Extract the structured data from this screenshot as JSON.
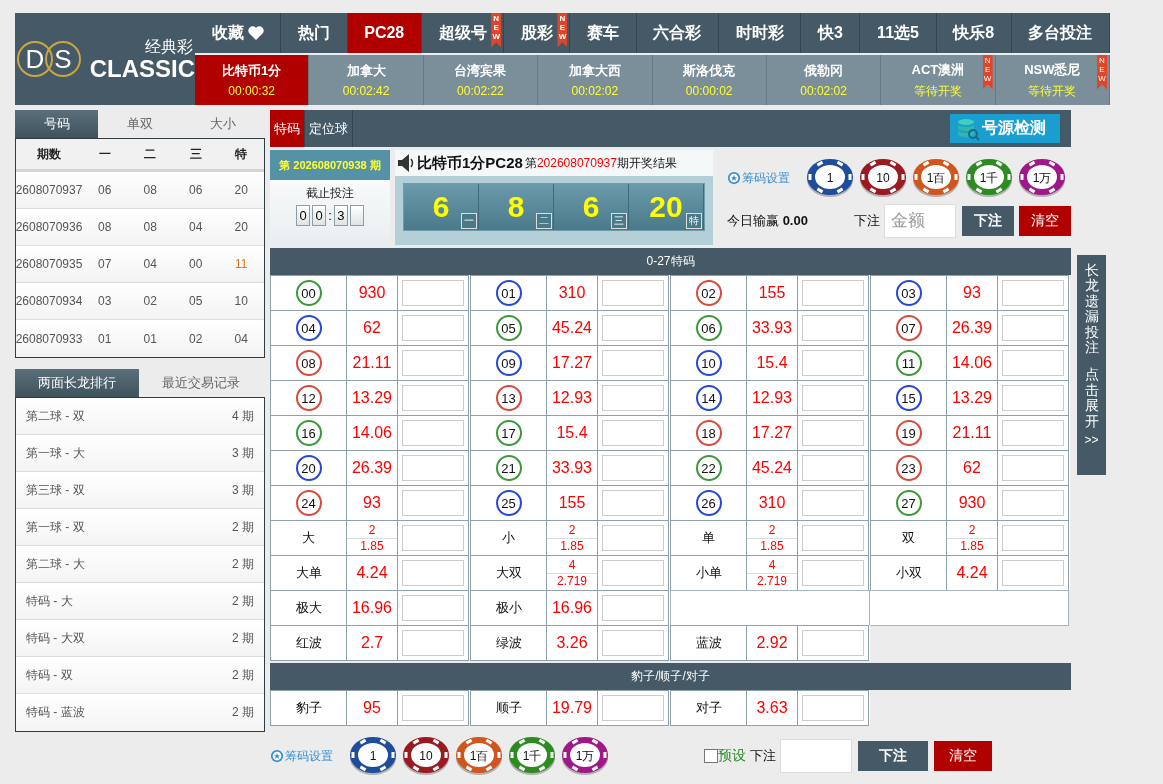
{
  "logo": {
    "letters": [
      "D",
      "S"
    ],
    "brand_cn": "经典彩",
    "brand_en": "CLASSIC"
  },
  "nav": [
    {
      "label": "收藏",
      "selected": false
    },
    {
      "label": "热门",
      "selected": false
    },
    {
      "label": "PC28",
      "selected": true
    },
    {
      "label": "超级号",
      "selected": false,
      "badge": "NEW"
    },
    {
      "label": "股彩",
      "selected": false,
      "badge": "NEW"
    },
    {
      "label": "赛车",
      "selected": false
    },
    {
      "label": "六合彩",
      "selected": false
    },
    {
      "label": "时时彩",
      "selected": false
    },
    {
      "label": "快3",
      "selected": false
    },
    {
      "label": "11选5",
      "selected": false
    },
    {
      "label": "快乐8",
      "selected": false
    },
    {
      "label": "多台投注",
      "selected": false
    }
  ],
  "games": [
    {
      "name": "比特币1分",
      "time": "00:00:32",
      "selected": true
    },
    {
      "name": "加拿大",
      "time": "00:02:42",
      "selected": false
    },
    {
      "name": "台湾宾果",
      "time": "00:02:22",
      "selected": false
    },
    {
      "name": "加拿大西",
      "time": "00:02:02",
      "selected": false
    },
    {
      "name": "斯洛伐克",
      "time": "00:00:02",
      "selected": false
    },
    {
      "name": "俄勒冈",
      "time": "00:02:02",
      "selected": false
    },
    {
      "name": "ACT澳洲",
      "time": "等待开奖",
      "selected": false,
      "badge": "NEW"
    },
    {
      "name": "NSW悉尼",
      "time": "等待开奖",
      "selected": false,
      "badge": "NEW"
    }
  ],
  "history_tabs": [
    {
      "label": "号码",
      "selected": true
    },
    {
      "label": "单双",
      "selected": false
    },
    {
      "label": "大小",
      "selected": false
    }
  ],
  "history": {
    "columns": [
      "期数",
      "一",
      "二",
      "三",
      "特"
    ],
    "rows": [
      {
        "cells": [
          "2608070937",
          "06",
          "08",
          "06",
          "20"
        ],
        "highlight": false
      },
      {
        "cells": [
          "2608070936",
          "08",
          "08",
          "04",
          "20"
        ],
        "highlight": false
      },
      {
        "cells": [
          "2608070935",
          "07",
          "04",
          "00",
          "11"
        ],
        "highlight": true
      },
      {
        "cells": [
          "2608070934",
          "03",
          "02",
          "05",
          "10"
        ],
        "highlight": false
      },
      {
        "cells": [
          "2608070933",
          "01",
          "01",
          "02",
          "04"
        ],
        "highlight": false
      }
    ]
  },
  "ranking_tabs": [
    {
      "label": "两面长龙排行",
      "selected": true
    },
    {
      "label": "最近交易记录",
      "selected": false
    }
  ],
  "ranking": [
    {
      "label": "第二球 - 双",
      "count": "4 期"
    },
    {
      "label": "第一球 - 大",
      "count": "3 期"
    },
    {
      "label": "第三球 - 双",
      "count": "3 期"
    },
    {
      "label": "第一球 - 双",
      "count": "2 期"
    },
    {
      "label": "第二球 - 大",
      "count": "2 期"
    },
    {
      "label": "特码 - 大",
      "count": "2 期"
    },
    {
      "label": "特码 - 大双",
      "count": "2 期"
    },
    {
      "label": "特码 - 双",
      "count": "2 期"
    },
    {
      "label": "特码 - 蓝波",
      "count": "2 期"
    }
  ],
  "bet_tabs": [
    {
      "label": "特码",
      "selected": true
    },
    {
      "label": "定位球",
      "selected": false
    }
  ],
  "source_button": "号源检测",
  "current": {
    "prefix": "第",
    "period": "202608070938",
    "suffix": "期",
    "deadline_label": "截止投注",
    "minutes": [
      "0",
      "0"
    ],
    "separator": ":",
    "seconds": [
      "3"
    ]
  },
  "result": {
    "game": "比特币1分PC28",
    "prefix": "第",
    "period": "202608070937",
    "suffix": "期开奖结果",
    "balls": [
      {
        "value": "6",
        "label": "一"
      },
      {
        "value": "8",
        "label": "二"
      },
      {
        "value": "6",
        "label": "三"
      },
      {
        "value": "20",
        "label": "特"
      }
    ]
  },
  "chip_setting": "筹码设置",
  "chips": [
    {
      "label": "1",
      "color": "#1f4c9c"
    },
    {
      "label": "10",
      "color": "#9a1a22"
    },
    {
      "label": "1百",
      "color": "#d0561e"
    },
    {
      "label": "1千",
      "color": "#2e8b22"
    },
    {
      "label": "1万",
      "color": "#a0178a"
    }
  ],
  "today": {
    "label": "今日输赢",
    "value": "0.00"
  },
  "bet": {
    "label": "下注",
    "placeholder": "金额",
    "submit": "下注",
    "clear": "清空"
  },
  "sections": [
    {
      "title": "0-27特码",
      "rows": [
        [
          {
            "kind": "ball",
            "number": "00",
            "color": "#3a9a3a",
            "odds": [
              "930"
            ]
          },
          {
            "kind": "ball",
            "number": "01",
            "color": "#2448d8",
            "odds": [
              "310"
            ]
          },
          {
            "kind": "ball",
            "number": "02",
            "color": "#d84a3a",
            "odds": [
              "155"
            ]
          },
          {
            "kind": "ball",
            "number": "03",
            "color": "#2448d8",
            "odds": [
              "93"
            ]
          }
        ],
        [
          {
            "kind": "ball",
            "number": "04",
            "color": "#2448d8",
            "odds": [
              "62"
            ]
          },
          {
            "kind": "ball",
            "number": "05",
            "color": "#3a9a3a",
            "odds": [
              "45.24"
            ]
          },
          {
            "kind": "ball",
            "number": "06",
            "color": "#3a9a3a",
            "odds": [
              "33.93"
            ]
          },
          {
            "kind": "ball",
            "number": "07",
            "color": "#d84a3a",
            "odds": [
              "26.39"
            ]
          }
        ],
        [
          {
            "kind": "ball",
            "number": "08",
            "color": "#d84a3a",
            "odds": [
              "21.11"
            ]
          },
          {
            "kind": "ball",
            "number": "09",
            "color": "#2448d8",
            "odds": [
              "17.27"
            ]
          },
          {
            "kind": "ball",
            "number": "10",
            "color": "#2448d8",
            "odds": [
              "15.4"
            ]
          },
          {
            "kind": "ball",
            "number": "11",
            "color": "#3a9a3a",
            "odds": [
              "14.06"
            ]
          }
        ],
        [
          {
            "kind": "ball",
            "number": "12",
            "color": "#d84a3a",
            "odds": [
              "13.29"
            ]
          },
          {
            "kind": "ball",
            "number": "13",
            "color": "#d84a3a",
            "odds": [
              "12.93"
            ]
          },
          {
            "kind": "ball",
            "number": "14",
            "color": "#2448d8",
            "odds": [
              "12.93"
            ]
          },
          {
            "kind": "ball",
            "number": "15",
            "color": "#2448d8",
            "odds": [
              "13.29"
            ]
          }
        ],
        [
          {
            "kind": "ball",
            "number": "16",
            "color": "#3a9a3a",
            "odds": [
              "14.06"
            ]
          },
          {
            "kind": "ball",
            "number": "17",
            "color": "#3a9a3a",
            "odds": [
              "15.4"
            ]
          },
          {
            "kind": "ball",
            "number": "18",
            "color": "#d84a3a",
            "odds": [
              "17.27"
            ]
          },
          {
            "kind": "ball",
            "number": "19",
            "color": "#d84a3a",
            "odds": [
              "21.11"
            ]
          }
        ],
        [
          {
            "kind": "ball",
            "number": "20",
            "color": "#2448d8",
            "odds": [
              "26.39"
            ]
          },
          {
            "kind": "ball",
            "number": "21",
            "color": "#3a9a3a",
            "odds": [
              "33.93"
            ]
          },
          {
            "kind": "ball",
            "number": "22",
            "color": "#3a9a3a",
            "odds": [
              "45.24"
            ]
          },
          {
            "kind": "ball",
            "number": "23",
            "color": "#d84a3a",
            "odds": [
              "62"
            ]
          }
        ],
        [
          {
            "kind": "ball",
            "number": "24",
            "color": "#d84a3a",
            "odds": [
              "93"
            ]
          },
          {
            "kind": "ball",
            "number": "25",
            "color": "#2448d8",
            "odds": [
              "155"
            ]
          },
          {
            "kind": "ball",
            "number": "26",
            "color": "#2448d8",
            "odds": [
              "310"
            ]
          },
          {
            "kind": "ball",
            "number": "27",
            "color": "#3a9a3a",
            "odds": [
              "930"
            ]
          }
        ],
        [
          {
            "kind": "option",
            "label": "大",
            "odds": [
              "2",
              "1.85"
            ]
          },
          {
            "kind": "option",
            "label": "小",
            "odds": [
              "2",
              "1.85"
            ]
          },
          {
            "kind": "option",
            "label": "单",
            "odds": [
              "2",
              "1.85"
            ]
          },
          {
            "kind": "option",
            "label": "双",
            "odds": [
              "2",
              "1.85"
            ]
          }
        ],
        [
          {
            "kind": "option",
            "label": "大单",
            "odds": [
              "4.24"
            ]
          },
          {
            "kind": "option",
            "label": "大双",
            "odds": [
              "4",
              "2.719"
            ]
          },
          {
            "kind": "option",
            "label": "小单",
            "odds": [
              "4",
              "2.719"
            ]
          },
          {
            "kind": "option",
            "label": "小双",
            "odds": [
              "4.24"
            ]
          }
        ],
        [
          {
            "kind": "option",
            "label": "极大",
            "odds": [
              "16.96"
            ]
          },
          {
            "kind": "option",
            "label": "极小",
            "odds": [
              "16.96"
            ]
          },
          {
            "kind": "empty",
            "bordered": true
          },
          {
            "kind": "empty",
            "bordered": true
          }
        ],
        [
          {
            "kind": "option",
            "label": "红波",
            "odds": [
              "2.7"
            ]
          },
          {
            "kind": "option",
            "label": "绿波",
            "odds": [
              "3.26"
            ]
          },
          {
            "kind": "option",
            "label": "蓝波",
            "odds": [
              "2.92"
            ]
          }
        ]
      ]
    },
    {
      "title": "豹子/顺子/对子",
      "rows": [
        [
          {
            "kind": "option",
            "label": "豹子",
            "odds": [
              "95"
            ]
          },
          {
            "kind": "option",
            "label": "顺子",
            "odds": [
              "19.79"
            ]
          },
          {
            "kind": "option",
            "label": "对子",
            "odds": [
              "3.63"
            ]
          }
        ]
      ]
    }
  ],
  "bottom": {
    "chip_setting": "筹码设置",
    "chips": [
      {
        "label": "1",
        "color": "#1f4c9c"
      },
      {
        "label": "10",
        "color": "#9a1a22"
      },
      {
        "label": "1百",
        "color": "#d0561e"
      },
      {
        "label": "1千",
        "color": "#2e8b22"
      },
      {
        "label": "1万",
        "color": "#a0178a"
      }
    ],
    "preset": {
      "label": "预设",
      "checked": false
    },
    "bet_label": "下注",
    "submit": "下注",
    "clear": "清空"
  },
  "side_tab": {
    "lines": [
      "长龙遗漏投注",
      "点击展开"
    ],
    "arrow": ">>"
  }
}
